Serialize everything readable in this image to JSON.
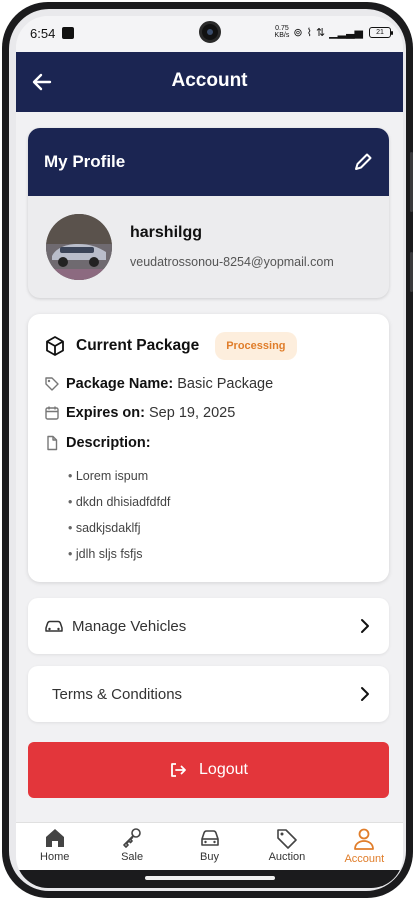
{
  "status_bar": {
    "time": "6:54",
    "speed": "0.75",
    "speed_unit": "KB/s",
    "battery": "21"
  },
  "header": {
    "title": "Account"
  },
  "profile": {
    "section_title": "My Profile",
    "name": "harshilgg",
    "email": "veudatrossonou-8254@yopmail.com"
  },
  "package": {
    "title": "Current Package",
    "status": "Processing",
    "name_label": "Package Name:",
    "name_value": "Basic Package",
    "expires_label": "Expires on:",
    "expires_value": "Sep 19, 2025",
    "description_label": "Description:",
    "description_items": [
      "Lorem ispum",
      "dkdn dhisiadfdfdf",
      "sadkjsdaklfj",
      "jdlh sljs fsfjs"
    ]
  },
  "menu": {
    "manage_vehicles": "Manage Vehicles",
    "terms": "Terms & Conditions",
    "logout": "Logout"
  },
  "bottom_nav": [
    {
      "label": "Home",
      "icon": "home-icon"
    },
    {
      "label": "Sale",
      "icon": "key-icon"
    },
    {
      "label": "Buy",
      "icon": "car-icon"
    },
    {
      "label": "Auction",
      "icon": "tag-icon"
    },
    {
      "label": "Account",
      "icon": "user-icon",
      "active": true
    }
  ],
  "colors": {
    "primary": "#1b2552",
    "accent": "#e07d2a",
    "danger": "#e3363b",
    "badge_bg": "#fdeedd"
  }
}
